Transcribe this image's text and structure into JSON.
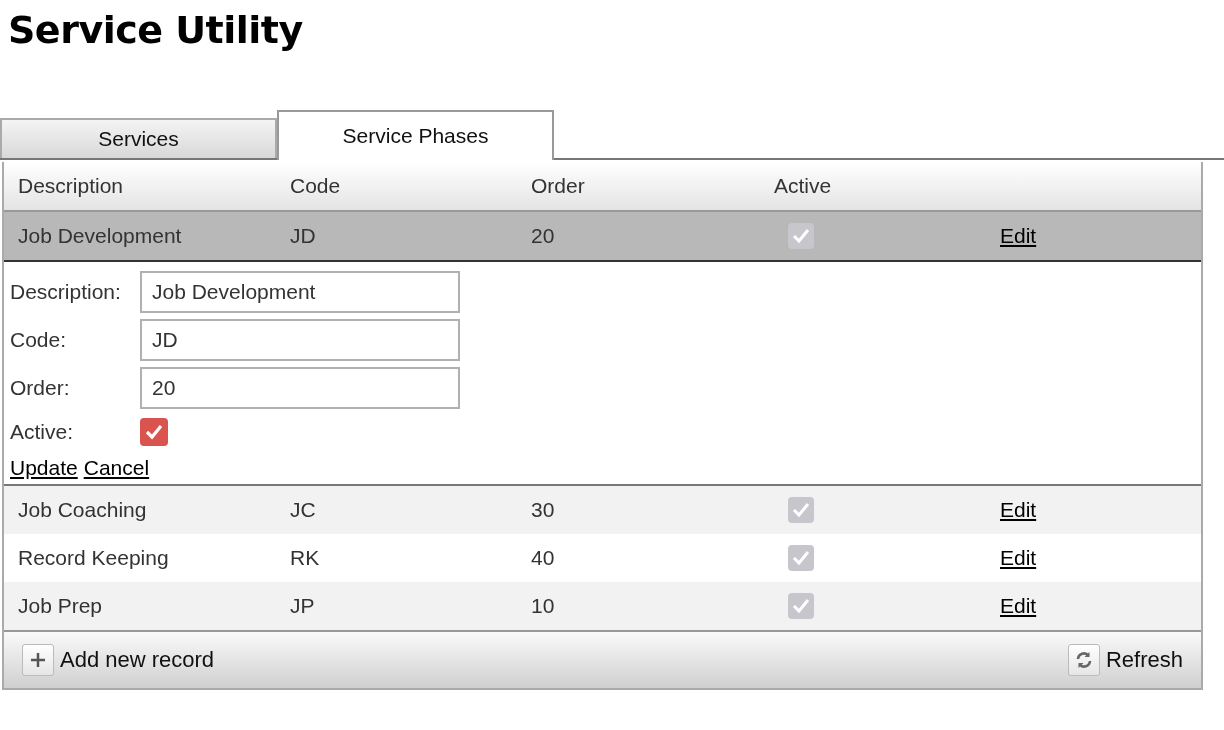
{
  "title": "Service Utility",
  "tabs": [
    {
      "label": "Services",
      "selected": false
    },
    {
      "label": "Service Phases",
      "selected": true
    }
  ],
  "grid": {
    "columns": [
      "Description",
      "Code",
      "Order",
      "Active"
    ],
    "rows": [
      {
        "description": "Job Development",
        "code": "JD",
        "order": "20",
        "active": true,
        "selected": true,
        "action": "Edit"
      },
      {
        "description": "Job Coaching",
        "code": "JC",
        "order": "30",
        "active": true,
        "selected": false,
        "action": "Edit"
      },
      {
        "description": "Record Keeping",
        "code": "RK",
        "order": "40",
        "active": true,
        "selected": false,
        "action": "Edit"
      },
      {
        "description": "Job Prep",
        "code": "JP",
        "order": "10",
        "active": true,
        "selected": false,
        "action": "Edit"
      }
    ],
    "edit_form": {
      "fields": [
        {
          "label": "Description:",
          "value": "Job Development"
        },
        {
          "label": "Code:",
          "value": "JD"
        },
        {
          "label": "Order:",
          "value": "20"
        }
      ],
      "active": {
        "label": "Active:",
        "checked": true
      },
      "actions": [
        "Update",
        "Cancel"
      ]
    },
    "toolbar": {
      "add": "Add new record",
      "refresh": "Refresh"
    }
  }
}
